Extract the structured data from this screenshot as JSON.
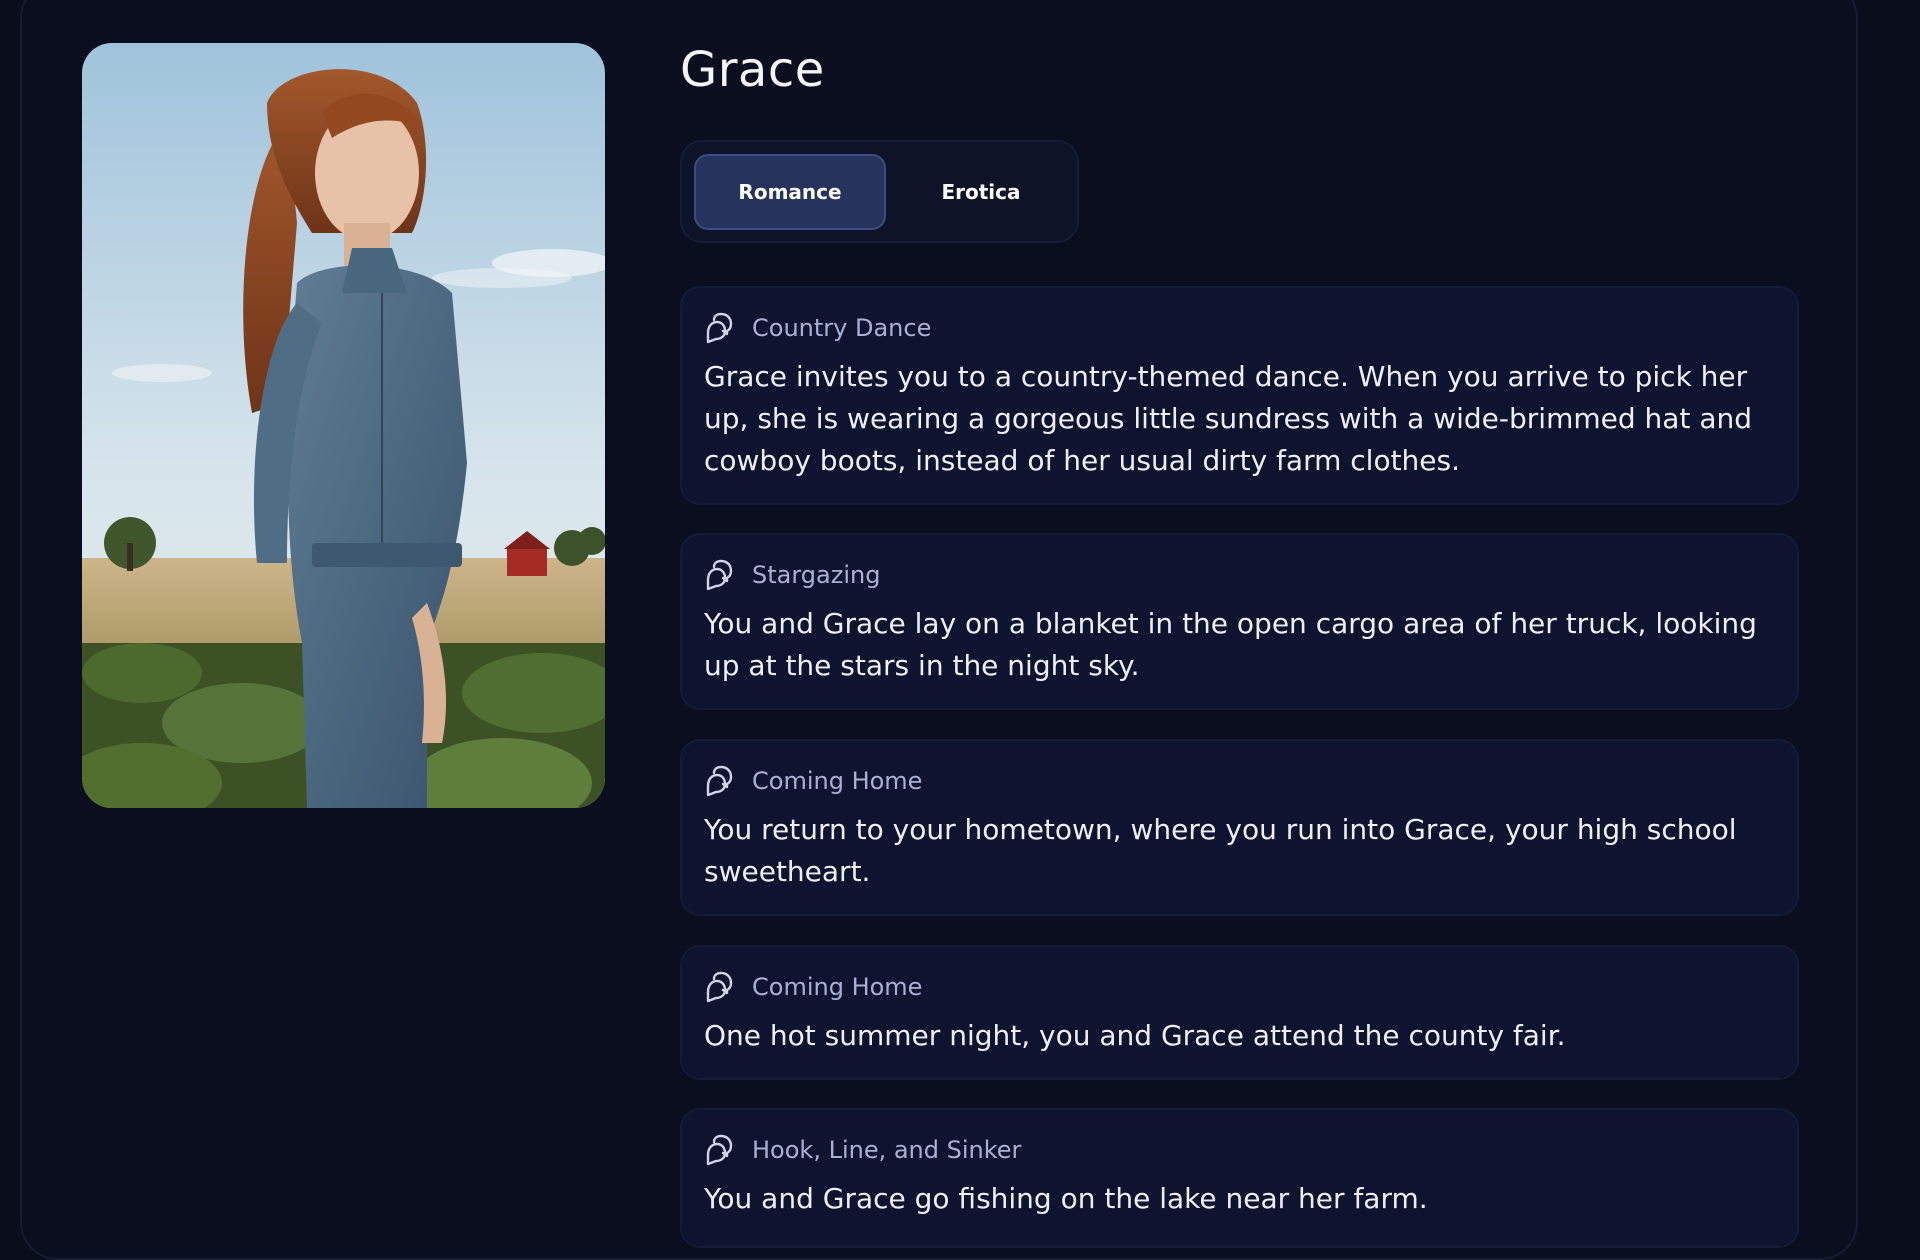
{
  "character": {
    "name": "Grace",
    "portrait_alt": "Grace in a denim outfit standing in a farm field"
  },
  "tabs": [
    {
      "label": "Romance",
      "active": true
    },
    {
      "label": "Erotica",
      "active": false
    }
  ],
  "scenarios": [
    {
      "icon": "chat-bubbles-icon",
      "title": "Country Dance",
      "description": "Grace invites you to a country-themed dance. When you arrive to pick her up, she is wearing a gorgeous little sundress with a wide-brimmed hat and cowboy boots, instead of her usual dirty farm clothes."
    },
    {
      "icon": "chat-bubbles-icon",
      "title": "Stargazing",
      "description": "You and Grace lay on a blanket in the open cargo area of her truck, looking up at the stars in the night sky."
    },
    {
      "icon": "chat-bubbles-icon",
      "title": "Coming Home",
      "description": "You return to your hometown, where you run into Grace, your high school sweetheart."
    },
    {
      "icon": "chat-bubbles-icon",
      "title": "Coming Home",
      "description": "One hot summer night, you and Grace attend the county fair."
    },
    {
      "icon": "chat-bubbles-icon",
      "title": "Hook, Line, and Sinker",
      "description": "You and Grace go fishing on the lake near her farm."
    }
  ],
  "colors": {
    "background": "#0a0d1c",
    "card": "#0e1430",
    "active_tab": "#26345d",
    "muted_text": "#a9b1d3"
  }
}
